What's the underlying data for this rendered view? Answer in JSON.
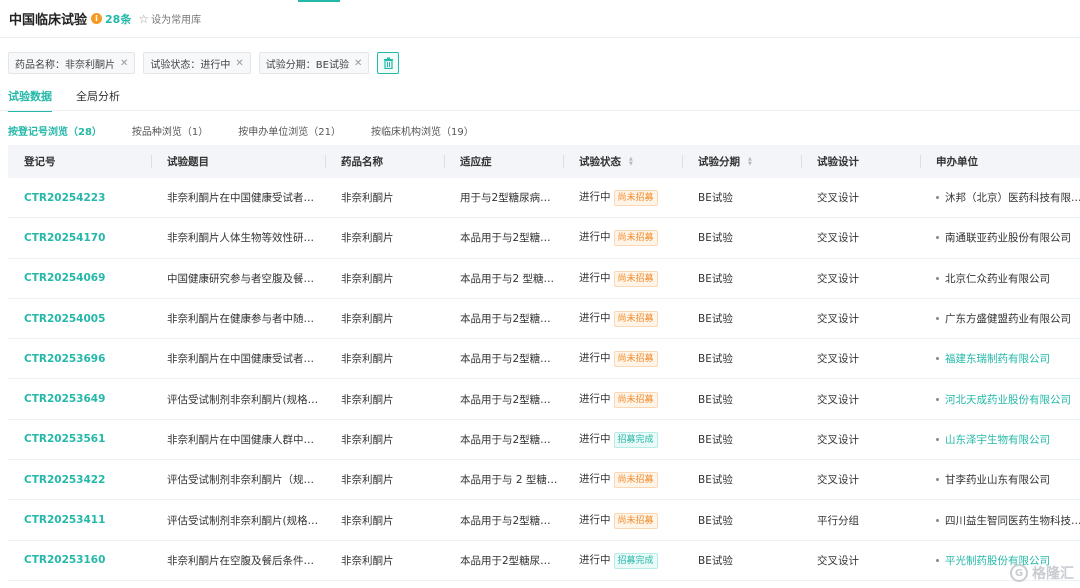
{
  "header": {
    "title": "中国临床试验",
    "count": "28条",
    "favorite_label": "设为常用库"
  },
  "filters": [
    {
      "label": "药品名称：非奈利酮片"
    },
    {
      "label": "试验状态：进行中"
    },
    {
      "label": "试验分期：BE试验"
    }
  ],
  "main_tabs": [
    {
      "label": "试验数据",
      "active": true
    },
    {
      "label": "全局分析",
      "active": false
    }
  ],
  "sub_tabs": [
    {
      "label": "按登记号浏览（28）",
      "active": true
    },
    {
      "label": "按品种浏览（1）",
      "active": false
    },
    {
      "label": "按申办单位浏览（21）",
      "active": false
    },
    {
      "label": "按临床机构浏览（19）",
      "active": false
    }
  ],
  "table": {
    "columns": [
      "登记号",
      "试验题目",
      "药品名称",
      "适应症",
      "试验状态",
      "试验分期",
      "试验设计",
      "申办单位"
    ],
    "rows": [
      {
        "reg": "CTR20254223",
        "title": "非奈利酮片在中国健康受试者…",
        "drug": "非奈利酮片",
        "indication": "用于与2型糖尿病…",
        "status": "进行中",
        "recruit": "尚未招募",
        "recruit_type": "orange",
        "phase": "BE试验",
        "design": "交叉设计",
        "sponsor": "沐邦（北京）医药科技有限…",
        "sponsor_link": false
      },
      {
        "reg": "CTR20254170",
        "title": "非奈利酮片人体生物等效性研…",
        "drug": "非奈利酮片",
        "indication": "本品用于与2型糖…",
        "status": "进行中",
        "recruit": "尚未招募",
        "recruit_type": "orange",
        "phase": "BE试验",
        "design": "交叉设计",
        "sponsor": "南通联亚药业股份有限公司",
        "sponsor_link": false
      },
      {
        "reg": "CTR20254069",
        "title": "中国健康研究参与者空腹及餐…",
        "drug": "非奈利酮片",
        "indication": "本品用于与2 型糖…",
        "status": "进行中",
        "recruit": "尚未招募",
        "recruit_type": "orange",
        "phase": "BE试验",
        "design": "交叉设计",
        "sponsor": "北京仁众药业有限公司",
        "sponsor_link": false
      },
      {
        "reg": "CTR20254005",
        "title": "非奈利酮片在健康参与者中随…",
        "drug": "非奈利酮片",
        "indication": "本品用于与2型糖…",
        "status": "进行中",
        "recruit": "尚未招募",
        "recruit_type": "orange",
        "phase": "BE试验",
        "design": "交叉设计",
        "sponsor": "广东方盛健盟药业有限公司",
        "sponsor_link": false
      },
      {
        "reg": "CTR20253696",
        "title": "非奈利酮片在中国健康受试者…",
        "drug": "非奈利酮片",
        "indication": "本品用于与2型糖…",
        "status": "进行中",
        "recruit": "尚未招募",
        "recruit_type": "orange",
        "phase": "BE试验",
        "design": "交叉设计",
        "sponsor": "福建东瑞制药有限公司",
        "sponsor_link": true
      },
      {
        "reg": "CTR20253649",
        "title": "评估受试制剂非奈利酮片(规格…",
        "drug": "非奈利酮片",
        "indication": "本品用于与2型糖…",
        "status": "进行中",
        "recruit": "尚未招募",
        "recruit_type": "orange",
        "phase": "BE试验",
        "design": "交叉设计",
        "sponsor": "河北天成药业股份有限公司",
        "sponsor_link": true
      },
      {
        "reg": "CTR20253561",
        "title": "非奈利酮片在中国健康人群中…",
        "drug": "非奈利酮片",
        "indication": "本品用于与2型糖…",
        "status": "进行中",
        "recruit": "招募完成",
        "recruit_type": "green",
        "phase": "BE试验",
        "design": "交叉设计",
        "sponsor": "山东泽宇生物有限公司",
        "sponsor_link": true
      },
      {
        "reg": "CTR20253422",
        "title": "评估受试制剂非奈利酮片（规…",
        "drug": "非奈利酮片",
        "indication": "本品用于与 2 型糖…",
        "status": "进行中",
        "recruit": "尚未招募",
        "recruit_type": "orange",
        "phase": "BE试验",
        "design": "交叉设计",
        "sponsor": "甘李药业山东有限公司",
        "sponsor_link": false
      },
      {
        "reg": "CTR20253411",
        "title": "评估受试制剂非奈利酮片(规格…",
        "drug": "非奈利酮片",
        "indication": "本品用于与2型糖…",
        "status": "进行中",
        "recruit": "尚未招募",
        "recruit_type": "orange",
        "phase": "BE试验",
        "design": "平行分组",
        "sponsor": "四川益生智同医药生物科技…",
        "sponsor_link": false
      },
      {
        "reg": "CTR20253160",
        "title": "非奈利酮片在空腹及餐后条件…",
        "drug": "非奈利酮片",
        "indication": "本品用于2型糖尿…",
        "status": "进行中",
        "recruit": "招募完成",
        "recruit_type": "green",
        "phase": "BE试验",
        "design": "交叉设计",
        "sponsor": "平光制药股份有限公司",
        "sponsor_link": true
      }
    ]
  },
  "watermark": "格隆汇",
  "colors": {
    "accent": "#25b8a9",
    "warning": "#f08c2c"
  }
}
